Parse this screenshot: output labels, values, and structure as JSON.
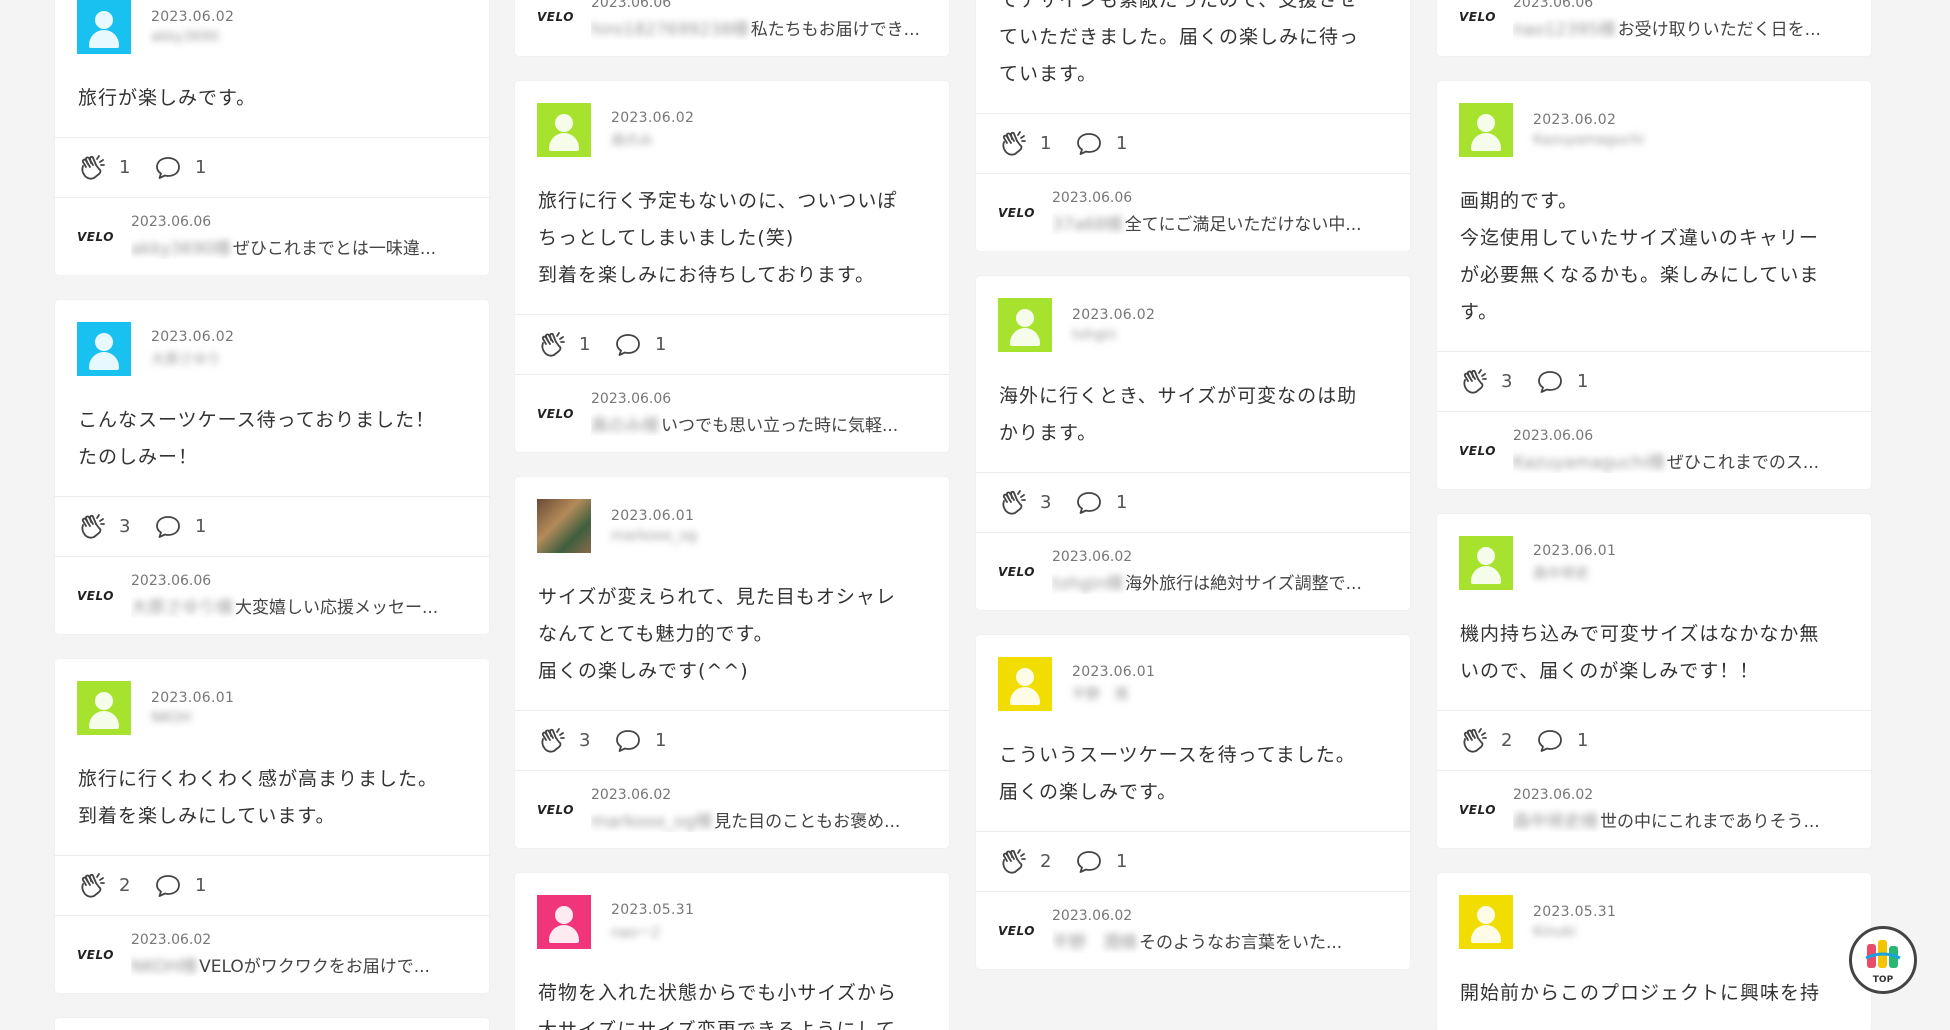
{
  "columns": [
    [
      {
        "date": "2023.06.02",
        "user": "akky3690",
        "avatar_color": "#19c1f0",
        "text": "旅行が楽しみです。",
        "claps": "1",
        "comments": "1",
        "reply": {
          "brand": "VELO",
          "date": "2023.06.06",
          "who": "akky3690様",
          "text": "ぜひこれまでとは一味違..."
        }
      },
      {
        "date": "2023.06.02",
        "user": "大原さゆり",
        "avatar_color": "#19c1f0",
        "text": "こんなスーツケース待っておりました！\nたのしみー！",
        "claps": "3",
        "comments": "1",
        "reply": {
          "brand": "VELO",
          "date": "2023.06.06",
          "who": "大原さゆり様",
          "text": "大変嬉しい応援メッセー..."
        }
      },
      {
        "date": "2023.06.01",
        "user": "NKOH",
        "avatar_color": "#a6e22e",
        "text": "旅行に行くわくわく感が高まりました。\n到着を楽しみにしています。",
        "claps": "2",
        "comments": "1",
        "reply": {
          "brand": "VELO",
          "date": "2023.06.02",
          "who": "NKOH様",
          "text": "VELOがワクワクをお届けで..."
        }
      },
      {
        "date": "",
        "user": "",
        "avatar_color": "#a6e22e",
        "text": "",
        "claps": "",
        "comments": "",
        "reply": null
      }
    ],
    [
      {
        "date": "",
        "user": "",
        "avatar_color": "",
        "text": "",
        "claps": "",
        "comments": "",
        "reply": {
          "brand": "VELO",
          "date": "2023.06.06",
          "who": "hiro1827699238様",
          "text": "私たちもお届けでき..."
        },
        "reply_only": true
      },
      {
        "date": "2023.06.02",
        "user": "高のみ",
        "avatar_color": "#a6e22e",
        "text": "旅行に行く予定もないのに、ついついぽ\nちっとしてしまいました(笑)\n到着を楽しみにお待ちしております。",
        "claps": "1",
        "comments": "1",
        "reply": {
          "brand": "VELO",
          "date": "2023.06.06",
          "who": "高のみ様",
          "text": "いつでも思い立った時に気軽..."
        }
      },
      {
        "date": "2023.06.01",
        "user": "markooo_og",
        "avatar_color": "photo",
        "text": "サイズが変えられて、見た目もオシャレ\nなんてとても魅力的です。\n届くの楽しみです(^^)",
        "claps": "3",
        "comments": "1",
        "reply": {
          "brand": "VELO",
          "date": "2023.06.02",
          "who": "markooo_og様",
          "text": "見た目のこともお褒め..."
        }
      },
      {
        "date": "2023.05.31",
        "user": "naoー2",
        "avatar_color": "#f0357a",
        "text": "荷物を入れた状態からでも小サイズから\n大サイズにサイズ変更できるようにして",
        "claps": "",
        "comments": "",
        "reply": null
      }
    ],
    [
      {
        "date": "",
        "user": "",
        "avatar_color": "",
        "text": "ら手が出ないので躊躇しましたが、画期的\nでデザインも素敵だったので、支援させ\nていただきました。届くの楽しみに待っ\nています。",
        "claps": "1",
        "comments": "1",
        "reply": {
          "brand": "VELO",
          "date": "2023.06.06",
          "who": "37a68様",
          "text": "全てにご満足いただけない中..."
        },
        "headless": true
      },
      {
        "date": "2023.06.02",
        "user": "tohgin",
        "avatar_color": "#a6e22e",
        "text": "海外に行くとき、サイズが可変なのは助\nかります。",
        "claps": "3",
        "comments": "1",
        "reply": {
          "brand": "VELO",
          "date": "2023.06.02",
          "who": "tohgin様",
          "text": "海外旅行は絶対サイズ調整で..."
        }
      },
      {
        "date": "2023.06.01",
        "user": "平野　潤",
        "avatar_color": "#f2dd00",
        "text": "こういうスーツケースを待ってました。\n届くの楽しみです。",
        "claps": "2",
        "comments": "1",
        "reply": {
          "brand": "VELO",
          "date": "2023.06.02",
          "who": "平野　潤様",
          "text": "そのようなお言葉をいた..."
        }
      }
    ],
    [
      {
        "date": "",
        "user": "",
        "avatar_color": "",
        "text": "",
        "claps": "",
        "comments": "",
        "reply": {
          "brand": "VELO",
          "date": "2023.06.06",
          "who": "nao12395様",
          "text": "お受け取りいただく日を..."
        },
        "reply_only": true
      },
      {
        "date": "2023.06.02",
        "user": "Kazuyamaguchi",
        "avatar_color": "#a6e22e",
        "text": "画期的です。\n今迄使用していたサイズ違いのキャリー\nが必要無くなるかも。楽しみにしていま\nす。",
        "claps": "3",
        "comments": "1",
        "reply": {
          "brand": "VELO",
          "date": "2023.06.06",
          "who": "Kazuyamaguchi様",
          "text": "ぜひこれまでのス..."
        }
      },
      {
        "date": "2023.06.01",
        "user": "森中将史",
        "avatar_color": "#a6e22e",
        "text": "機内持ち込みで可変サイズはなかなか無\nいので、届くのが楽しみです！！",
        "claps": "2",
        "comments": "1",
        "reply": {
          "brand": "VELO",
          "date": "2023.06.02",
          "who": "森中将史様",
          "text": "世の中にこれまでありそう..."
        }
      },
      {
        "date": "2023.05.31",
        "user": "Kinuki",
        "avatar_color": "#f2dd00",
        "text": "開始前からこのプロジェクトに興味を持",
        "claps": "",
        "comments": "",
        "reply": null
      }
    ]
  ],
  "top_button": {
    "label": "TOP"
  }
}
